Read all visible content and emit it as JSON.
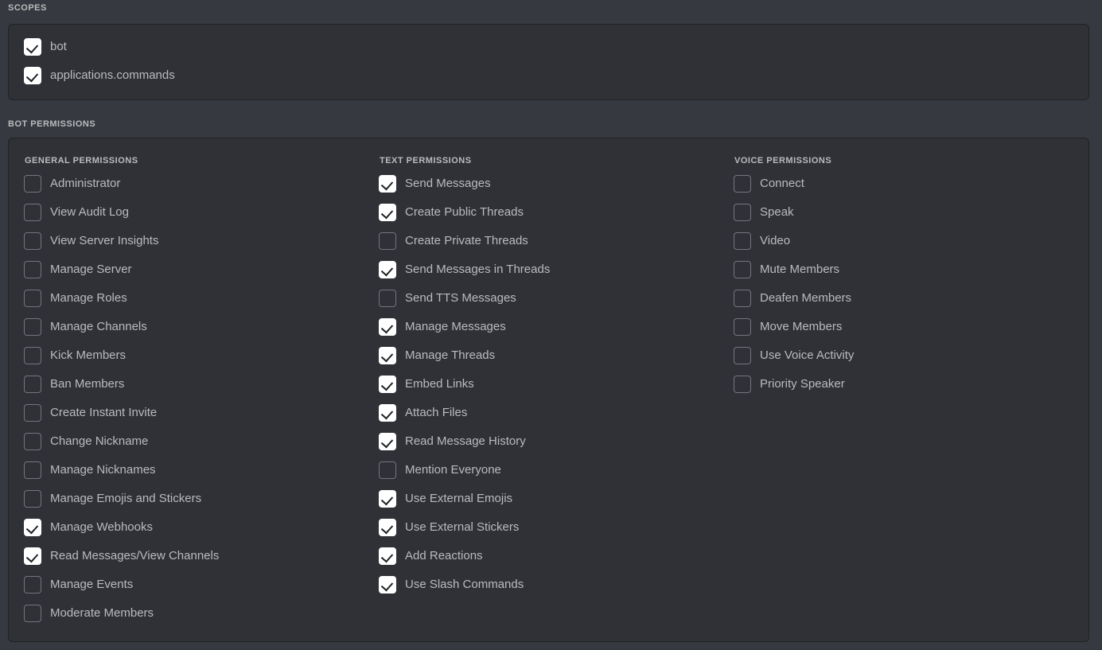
{
  "sections": {
    "scopes_heading": "SCOPES",
    "bot_permissions_heading": "BOT PERMISSIONS"
  },
  "colors": {
    "page_background": "#36393f",
    "panel_background": "#2f3136",
    "panel_border": "#202225",
    "label_text": "#b9bbbe",
    "heading_text": "#b9bbbe",
    "checkbox_checked_fill": "#ffffff",
    "checkbox_checkmark": "#1e2124",
    "checkbox_unchecked_border": "#72767d"
  },
  "scopes": {
    "items": [
      {
        "label": "bot",
        "checked": true
      },
      {
        "label": "applications.commands",
        "checked": true
      }
    ]
  },
  "bot_permissions": {
    "columns": [
      {
        "heading": "GENERAL PERMISSIONS",
        "items": [
          {
            "label": "Administrator",
            "checked": false
          },
          {
            "label": "View Audit Log",
            "checked": false
          },
          {
            "label": "View Server Insights",
            "checked": false
          },
          {
            "label": "Manage Server",
            "checked": false
          },
          {
            "label": "Manage Roles",
            "checked": false
          },
          {
            "label": "Manage Channels",
            "checked": false
          },
          {
            "label": "Kick Members",
            "checked": false
          },
          {
            "label": "Ban Members",
            "checked": false
          },
          {
            "label": "Create Instant Invite",
            "checked": false
          },
          {
            "label": "Change Nickname",
            "checked": false
          },
          {
            "label": "Manage Nicknames",
            "checked": false
          },
          {
            "label": "Manage Emojis and Stickers",
            "checked": false
          },
          {
            "label": "Manage Webhooks",
            "checked": true
          },
          {
            "label": "Read Messages/View Channels",
            "checked": true
          },
          {
            "label": "Manage Events",
            "checked": false
          },
          {
            "label": "Moderate Members",
            "checked": false
          }
        ]
      },
      {
        "heading": "TEXT PERMISSIONS",
        "items": [
          {
            "label": "Send Messages",
            "checked": true
          },
          {
            "label": "Create Public Threads",
            "checked": true
          },
          {
            "label": "Create Private Threads",
            "checked": false
          },
          {
            "label": "Send Messages in Threads",
            "checked": true
          },
          {
            "label": "Send TTS Messages",
            "checked": false
          },
          {
            "label": "Manage Messages",
            "checked": true
          },
          {
            "label": "Manage Threads",
            "checked": true
          },
          {
            "label": "Embed Links",
            "checked": true
          },
          {
            "label": "Attach Files",
            "checked": true
          },
          {
            "label": "Read Message History",
            "checked": true
          },
          {
            "label": "Mention Everyone",
            "checked": false
          },
          {
            "label": "Use External Emojis",
            "checked": true
          },
          {
            "label": "Use External Stickers",
            "checked": true
          },
          {
            "label": "Add Reactions",
            "checked": true
          },
          {
            "label": "Use Slash Commands",
            "checked": true
          }
        ]
      },
      {
        "heading": "VOICE PERMISSIONS",
        "items": [
          {
            "label": "Connect",
            "checked": false
          },
          {
            "label": "Speak",
            "checked": false
          },
          {
            "label": "Video",
            "checked": false
          },
          {
            "label": "Mute Members",
            "checked": false
          },
          {
            "label": "Deafen Members",
            "checked": false
          },
          {
            "label": "Move Members",
            "checked": false
          },
          {
            "label": "Use Voice Activity",
            "checked": false
          },
          {
            "label": "Priority Speaker",
            "checked": false
          }
        ]
      }
    ]
  }
}
